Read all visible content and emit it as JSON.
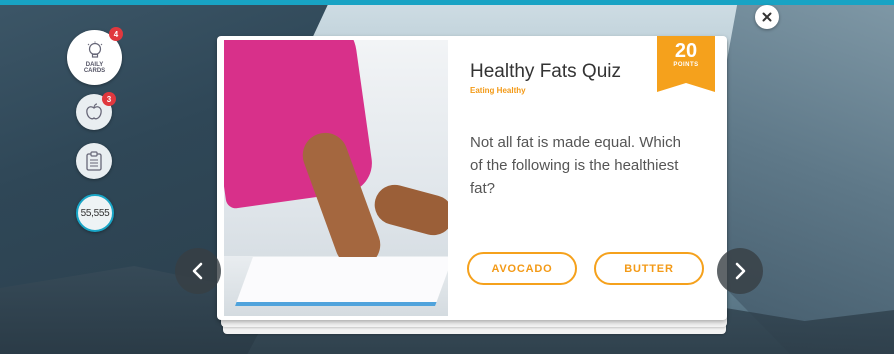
{
  "sidebar": {
    "daily_cards": {
      "label_line1": "DAILY",
      "label_line2": "CARDS",
      "badge": "4",
      "icon": "lightbulb-icon"
    },
    "health": {
      "badge": "3",
      "icon": "apple-icon"
    },
    "tasks": {
      "icon": "clipboard-icon"
    },
    "points_total": "55,555"
  },
  "card": {
    "title": "Healthy Fats Quiz",
    "category": "Eating Healthy",
    "question": "Not all fat is made equal. Which of the following is the healthiest fat?",
    "points_value": "20",
    "points_label": "POINTS",
    "answers": [
      {
        "label": "AVOCADO"
      },
      {
        "label": "BUTTER"
      }
    ]
  },
  "nav": {
    "prev_icon": "chevron-left-icon",
    "next_icon": "chevron-right-icon",
    "close_icon": "close-icon"
  },
  "colors": {
    "accent": "#f5a11c",
    "topbar": "#18a3c4",
    "badge": "#e0383e"
  }
}
